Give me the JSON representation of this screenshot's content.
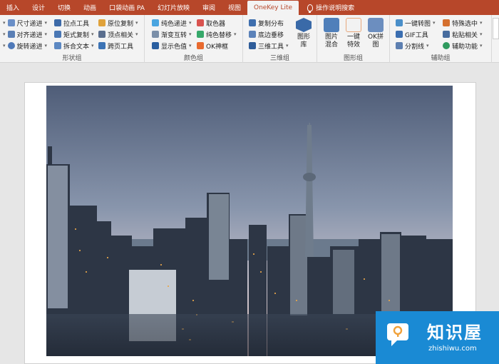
{
  "tabs": [
    "插入",
    "设计",
    "切换",
    "动画",
    "口袋动画 PA",
    "幻灯片放映",
    "审阅",
    "视图",
    "OneKey Lite",
    "操作说明搜索"
  ],
  "ribbon": {
    "shape_group": {
      "label": "形状组",
      "cmds": [
        "尺寸递进",
        "对齐递进",
        "旋转递进",
        "拉点工具",
        "矩式复制",
        "拆合文本",
        "原位复制",
        "顶点相关",
        "跨页工具"
      ]
    },
    "color_group": {
      "label": "颜色组",
      "cmds": [
        "纯色递进",
        "渐变互转",
        "显示色值",
        "取色器",
        "纯色替移",
        "OK神框"
      ]
    },
    "3d_group": {
      "label": "三维组",
      "cmds": [
        "复制分布",
        "底边垂移",
        "三维工具"
      ],
      "big": "图形库"
    },
    "image_group": {
      "label": "图形组",
      "big": [
        "图片混合",
        "一键特效",
        "OK拼图"
      ]
    },
    "aux_group": {
      "label": "辅助组",
      "cmds": [
        "一键转图",
        "GIF工具",
        "分割线",
        "特殊选中",
        "粘贴相关",
        "辅助功能"
      ]
    }
  },
  "watermark": {
    "name": "知识屋",
    "url": "zhishiwu.com"
  },
  "colors": {
    "tab_bar": "#b7472a",
    "ribbon": "#f3f3f3",
    "watermark": "#1a8ad4"
  }
}
